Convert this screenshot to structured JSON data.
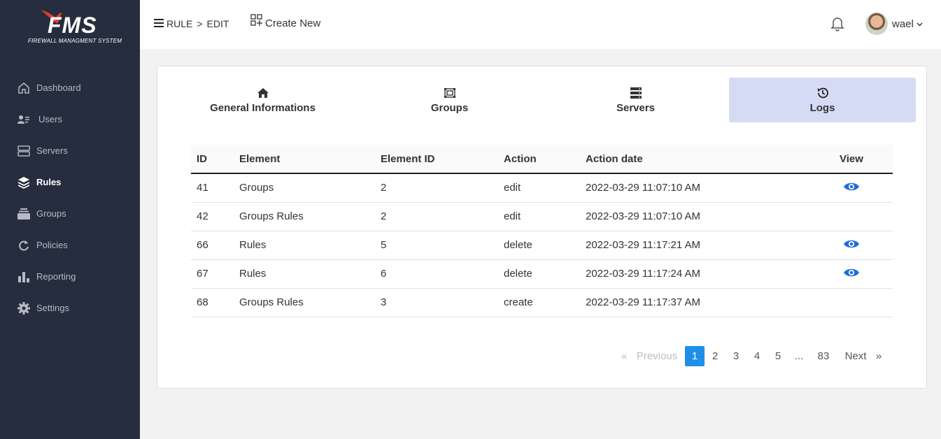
{
  "app": {
    "logo_text": "FMS",
    "logo_subtitle": "FIREWALL MANAGMENT SYSTEM"
  },
  "sidebar": {
    "items": [
      {
        "label": "Dashboard",
        "icon": "home-icon",
        "active": false
      },
      {
        "label": "Users",
        "icon": "users-icon",
        "active": false
      },
      {
        "label": "Servers",
        "icon": "server-icon",
        "active": false
      },
      {
        "label": "Rules",
        "icon": "layers-icon",
        "active": true
      },
      {
        "label": "Groups",
        "icon": "stack-icon",
        "active": false
      },
      {
        "label": "Policies",
        "icon": "sync-icon",
        "active": false
      },
      {
        "label": "Reporting",
        "icon": "bar-chart-icon",
        "active": false
      },
      {
        "label": "Settings",
        "icon": "gear-icon",
        "active": false
      }
    ]
  },
  "header": {
    "breadcrumb_root": "RULE",
    "breadcrumb_sep": ">",
    "breadcrumb_leaf": "EDIT",
    "create_new": "Create New",
    "username": "wael"
  },
  "tabs": [
    {
      "label": "General Informations",
      "icon": "home-icon",
      "active": false
    },
    {
      "label": "Groups",
      "icon": "group-icon",
      "active": false
    },
    {
      "label": "Servers",
      "icon": "server-icon",
      "active": false
    },
    {
      "label": "Logs",
      "icon": "history-icon",
      "active": true
    }
  ],
  "logs_table": {
    "columns": [
      "ID",
      "Element",
      "Element ID",
      "Action",
      "Action date",
      "View"
    ],
    "rows": [
      {
        "id": "41",
        "element": "Groups",
        "element_id": "2",
        "action": "edit",
        "date": "2022-03-29 11:07:10 AM",
        "has_view": true
      },
      {
        "id": "42",
        "element": "Groups Rules",
        "element_id": "2",
        "action": "edit",
        "date": "2022-03-29 11:07:10 AM",
        "has_view": false
      },
      {
        "id": "66",
        "element": "Rules",
        "element_id": "5",
        "action": "delete",
        "date": "2022-03-29 11:17:21 AM",
        "has_view": true
      },
      {
        "id": "67",
        "element": "Rules",
        "element_id": "6",
        "action": "delete",
        "date": "2022-03-29 11:17:24 AM",
        "has_view": true
      },
      {
        "id": "68",
        "element": "Groups Rules",
        "element_id": "3",
        "action": "create",
        "date": "2022-03-29 11:17:37 AM",
        "has_view": false
      }
    ]
  },
  "pagination": {
    "first": "«",
    "previous": "Previous",
    "pages": [
      "1",
      "2",
      "3",
      "4",
      "5"
    ],
    "ellipsis": "...",
    "last_page": "83",
    "next": "Next",
    "last": "»",
    "current": "1"
  },
  "colors": {
    "sidebar_bg": "#262d3e",
    "active_tab_bg": "#d5dbf5",
    "accent": "#1d8fe8",
    "logo_red": "#e03a2f"
  }
}
